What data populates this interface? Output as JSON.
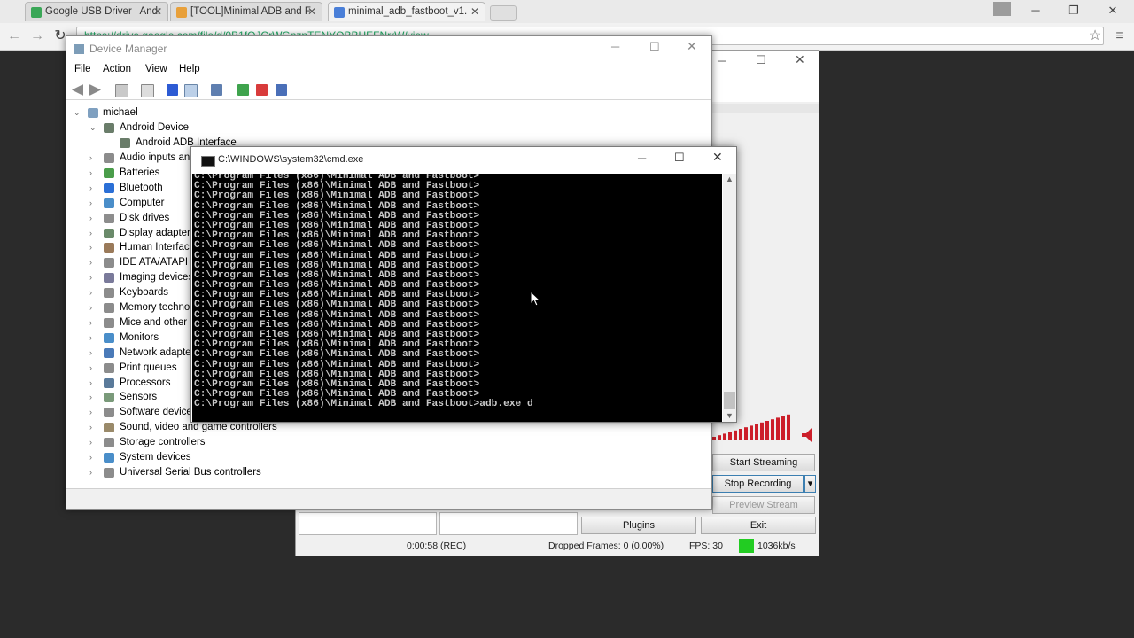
{
  "chrome": {
    "tabs": [
      {
        "title": "Google USB Driver | Andr",
        "active": false,
        "favicon_color": "#3aa757"
      },
      {
        "title": "[TOOL]Minimal ADB and F",
        "active": false,
        "favicon_color": "#e8a03a"
      },
      {
        "title": "minimal_adb_fastboot_v1.",
        "active": true,
        "favicon_color": "#4a7fd8"
      }
    ],
    "url": "https://drive.google.com/file/d/0B1fOJCrWGnznTENYOBBUEFNrrW/view"
  },
  "obs": {
    "buttons": {
      "start_streaming": "Start Streaming",
      "stop_recording": "Stop Recording",
      "preview_stream": "Preview Stream",
      "plugins": "Plugins",
      "exit": "Exit"
    },
    "status": {
      "time": "0:00:58 (REC)",
      "dropped": "Dropped Frames: 0 (0.00%)",
      "fps": "FPS: 30",
      "bitrate": "1036kb/s"
    },
    "colors": {
      "meter": "#cc1f2a",
      "bitrate_indicator": "#22cc22"
    }
  },
  "device_manager": {
    "title": "Device Manager",
    "menu": [
      "File",
      "Action",
      "View",
      "Help"
    ],
    "root": "michael",
    "expanded_category": "Android Device",
    "expanded_child": "Android ADB Interface",
    "categories": [
      "Audio inputs and outputs",
      "Batteries",
      "Bluetooth",
      "Computer",
      "Disk drives",
      "Display adapters",
      "Human Interface Devices",
      "IDE ATA/ATAPI controllers",
      "Imaging devices",
      "Keyboards",
      "Memory technology devices",
      "Mice and other pointing devices",
      "Monitors",
      "Network adapters",
      "Print queues",
      "Processors",
      "Sensors",
      "Software devices",
      "Sound, video and game controllers",
      "Storage controllers",
      "System devices",
      "Universal Serial Bus controllers"
    ]
  },
  "cmd": {
    "title": "C:\\WINDOWS\\system32\\cmd.exe",
    "prompt": "C:\\Program Files (x86)\\Minimal ADB and Fastboot>",
    "prompt_line_count": 24,
    "last_command": "adb.exe d"
  }
}
